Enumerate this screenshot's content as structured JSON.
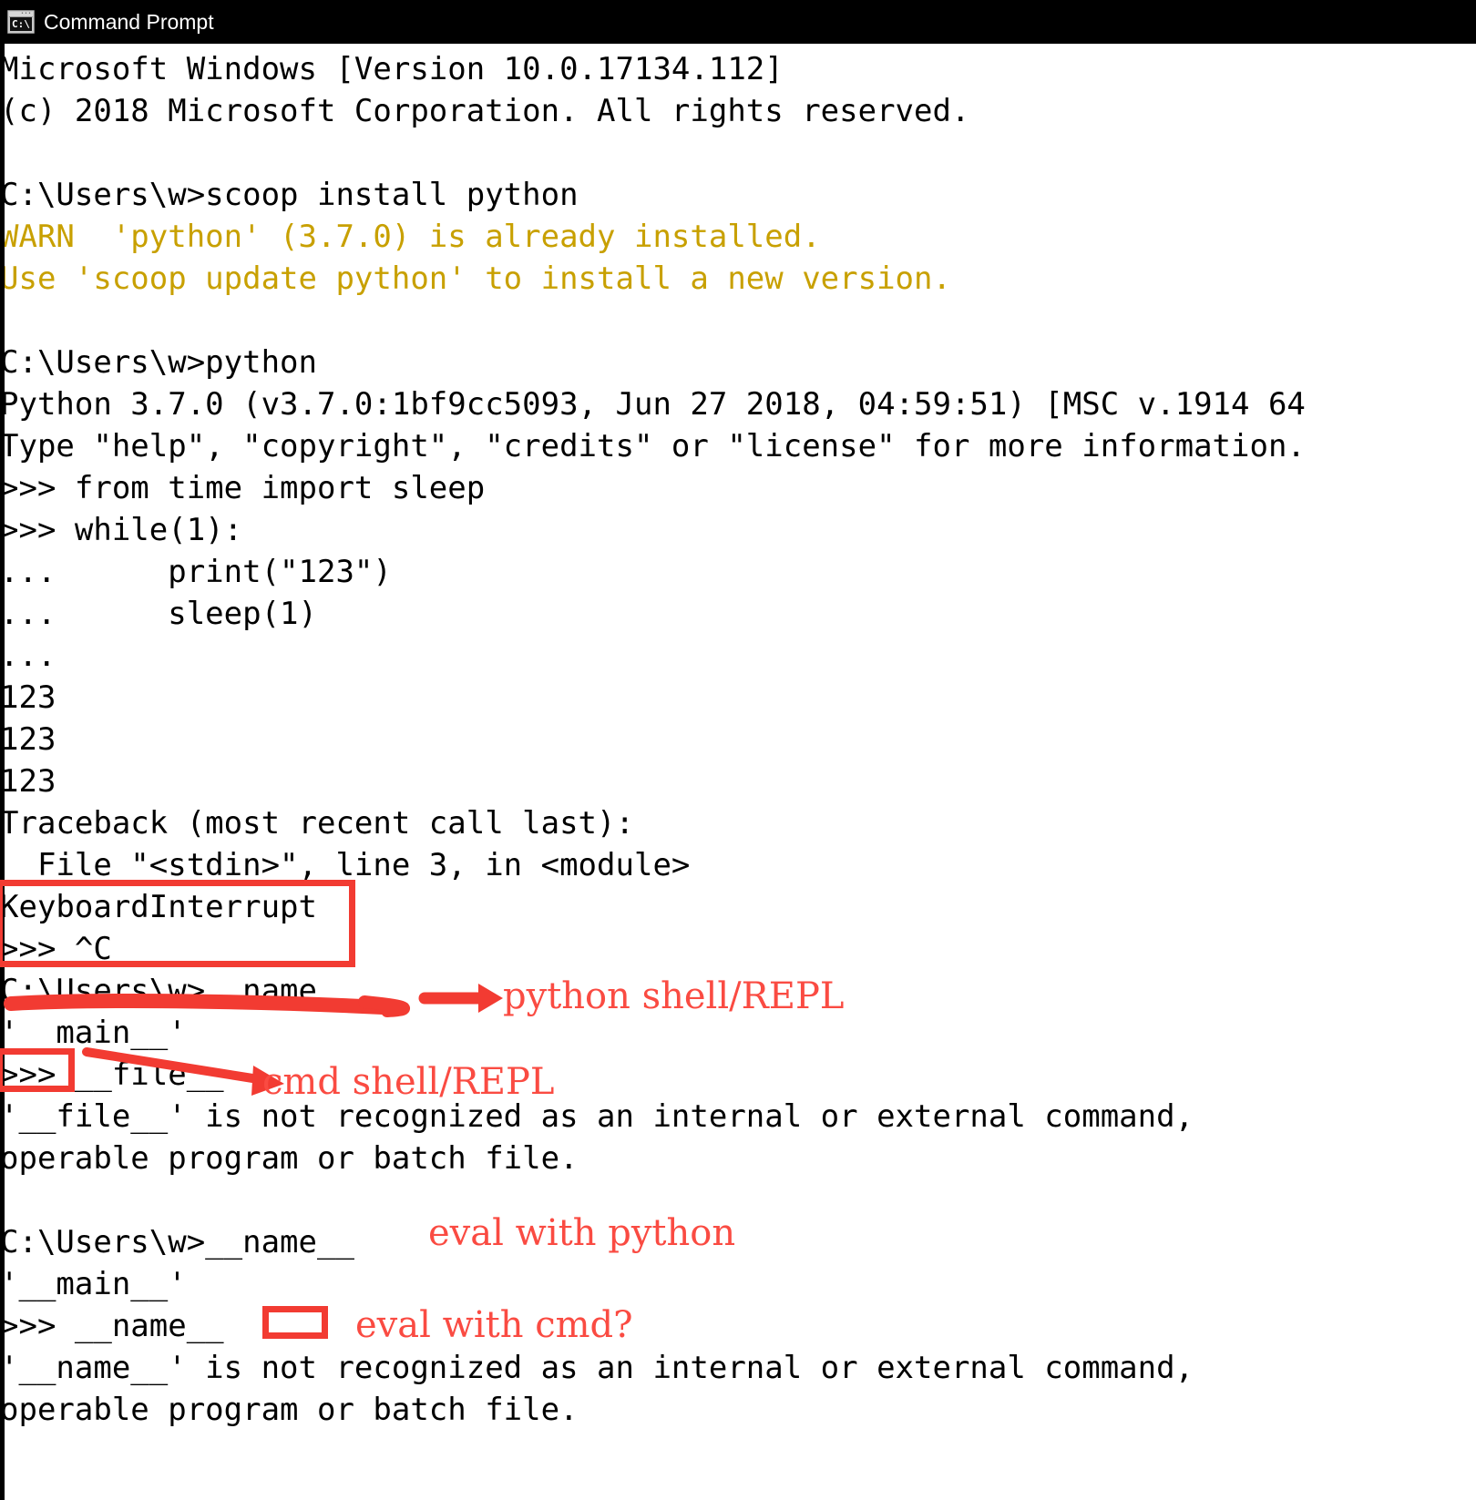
{
  "window": {
    "title": "Command Prompt",
    "icon": "command-prompt-icon",
    "icon_glyph": "C:\\.",
    "titlebar_bg": "#000000",
    "console_bg": "#ffffff",
    "console_fg": "#000000"
  },
  "colors": {
    "warn": "#c8a000",
    "annotation_red": "#fa4b42",
    "annotation_box_red": "#f23b32"
  },
  "console": {
    "lines": [
      {
        "text": "Microsoft Windows [Version 10.0.17134.112]",
        "style": "normal"
      },
      {
        "text": "(c) 2018 Microsoft Corporation. All rights reserved.",
        "style": "normal"
      },
      {
        "text": "",
        "style": "normal"
      },
      {
        "text": "C:\\Users\\w>scoop install python",
        "style": "normal"
      },
      {
        "text": "WARN  'python' (3.7.0) is already installed.",
        "style": "warn"
      },
      {
        "text": "Use 'scoop update python' to install a new version.",
        "style": "warn"
      },
      {
        "text": "",
        "style": "normal"
      },
      {
        "text": "C:\\Users\\w>python",
        "style": "normal"
      },
      {
        "text": "Python 3.7.0 (v3.7.0:1bf9cc5093, Jun 27 2018, 04:59:51) [MSC v.1914 64",
        "style": "normal"
      },
      {
        "text": "Type \"help\", \"copyright\", \"credits\" or \"license\" for more information.",
        "style": "normal"
      },
      {
        "text": ">>> from time import sleep",
        "style": "normal"
      },
      {
        "text": ">>> while(1):",
        "style": "normal"
      },
      {
        "text": "...      print(\"123\")",
        "style": "normal"
      },
      {
        "text": "...      sleep(1)",
        "style": "normal"
      },
      {
        "text": "...",
        "style": "normal"
      },
      {
        "text": "123",
        "style": "normal"
      },
      {
        "text": "123",
        "style": "normal"
      },
      {
        "text": "123",
        "style": "normal"
      },
      {
        "text": "Traceback (most recent call last):",
        "style": "normal"
      },
      {
        "text": "  File \"<stdin>\", line 3, in <module>",
        "style": "normal"
      },
      {
        "text": "KeyboardInterrupt",
        "style": "normal"
      },
      {
        "text": ">>> ^C",
        "style": "normal"
      },
      {
        "text": "C:\\Users\\w>__name__",
        "style": "normal"
      },
      {
        "text": "'__main__'",
        "style": "normal"
      },
      {
        "text": ">>> __file__",
        "style": "normal"
      },
      {
        "text": "'__file__' is not recognized as an internal or external command,",
        "style": "normal"
      },
      {
        "text": "operable program or batch file.",
        "style": "normal"
      },
      {
        "text": "",
        "style": "normal"
      },
      {
        "text": "C:\\Users\\w>__name__",
        "style": "normal"
      },
      {
        "text": "'__main__'",
        "style": "normal"
      },
      {
        "text": ">>> __name__",
        "style": "normal"
      },
      {
        "text": "'__name__' is not recognized as an internal or external command,",
        "style": "normal"
      },
      {
        "text": "operable program or batch file.",
        "style": "normal"
      }
    ]
  },
  "annotations": {
    "labels": [
      {
        "id": "python-shell-repl",
        "text": "python shell/REPL"
      },
      {
        "id": "cmd-shell-repl",
        "text": "cmd shell/REPL"
      },
      {
        "id": "eval-with-python",
        "text": "eval with python"
      },
      {
        "id": "eval-with-cmd",
        "text": "eval with cmd?"
      }
    ],
    "shapes": [
      {
        "id": "keyboardinterrupt-highlight-box",
        "kind": "rectangle"
      },
      {
        "id": "prompt-marker-box",
        "kind": "rectangle"
      },
      {
        "id": "empty-marker-box",
        "kind": "rectangle"
      },
      {
        "id": "name-underline",
        "kind": "underline"
      },
      {
        "id": "arrow-to-python-shell",
        "kind": "arrow"
      },
      {
        "id": "arrow-to-cmd-shell",
        "kind": "arrow"
      }
    ]
  }
}
